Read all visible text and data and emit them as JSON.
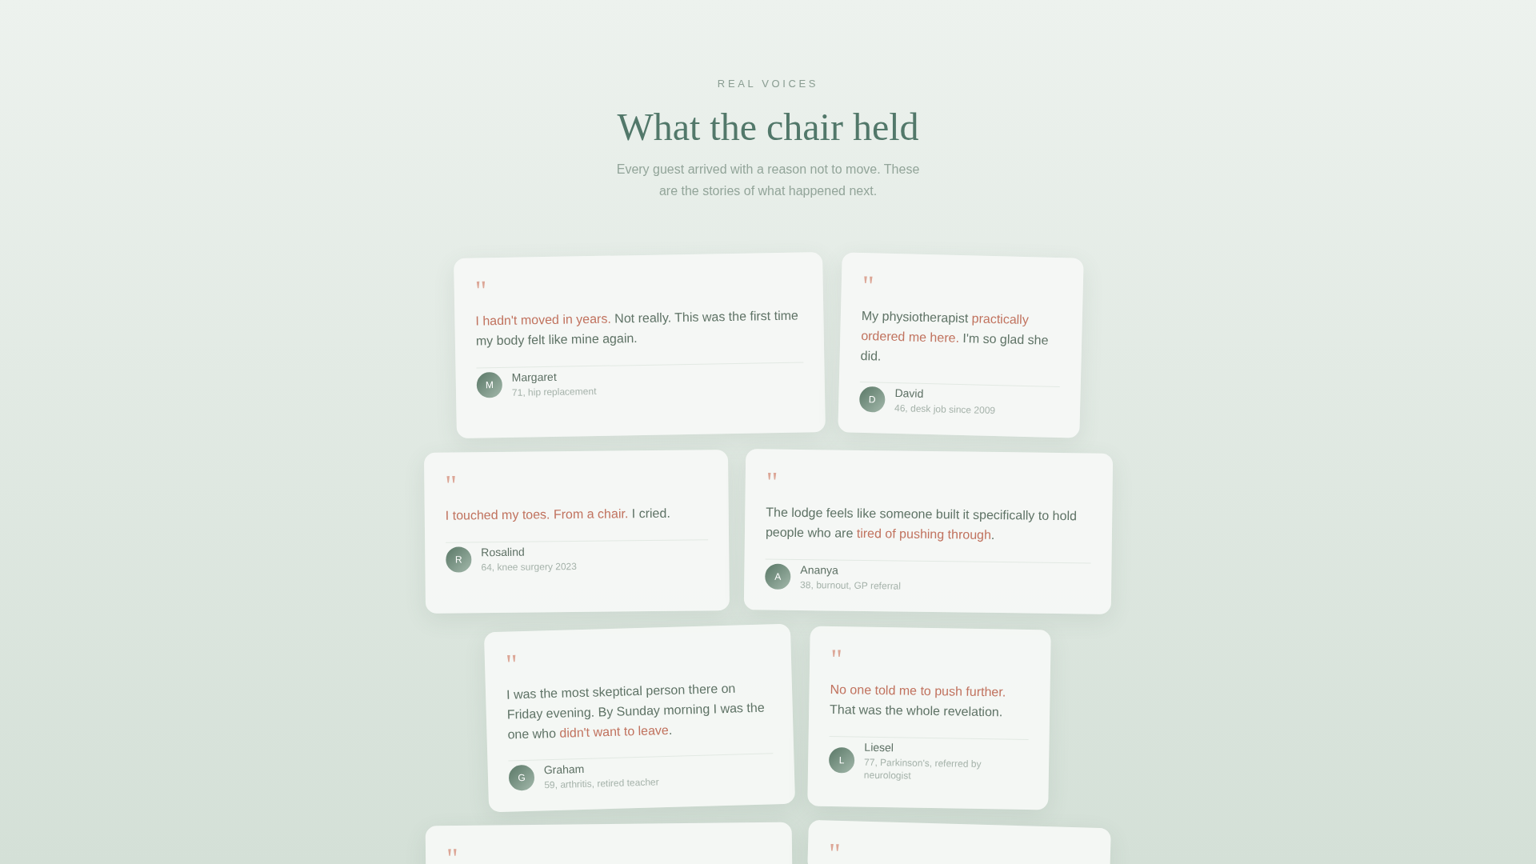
{
  "header": {
    "eyebrow": "REAL VOICES",
    "title": "What the chair held",
    "subtitle": "Every guest arrived with a reason not to move. These are the stories of what happened next."
  },
  "testimonials": [
    {
      "mark": "\"",
      "quote": [
        {
          "text": "I hadn't moved in years.",
          "highlight": true
        },
        {
          "text": " Not really. This was the first time my body felt like mine again.",
          "highlight": false
        }
      ],
      "author": {
        "initial": "M",
        "name": "Margaret",
        "detail": "71, hip replacement"
      }
    },
    {
      "mark": "\"",
      "quote": [
        {
          "text": "My physiotherapist ",
          "highlight": false
        },
        {
          "text": "practically ordered me here.",
          "highlight": true
        },
        {
          "text": " I'm so glad she did.",
          "highlight": false
        }
      ],
      "author": {
        "initial": "D",
        "name": "David",
        "detail": "46, desk job since 2009"
      }
    },
    {
      "mark": "\"",
      "quote": [
        {
          "text": "I touched my toes. From a chair.",
          "highlight": true
        },
        {
          "text": " I cried.",
          "highlight": false
        }
      ],
      "author": {
        "initial": "R",
        "name": "Rosalind",
        "detail": "64, knee surgery 2023"
      }
    },
    {
      "mark": "\"",
      "quote": [
        {
          "text": "The lodge feels like someone built it specifically to hold people who are ",
          "highlight": false
        },
        {
          "text": "tired of pushing through",
          "highlight": true
        },
        {
          "text": ".",
          "highlight": false
        }
      ],
      "author": {
        "initial": "A",
        "name": "Ananya",
        "detail": "38, burnout, GP referral"
      }
    },
    {
      "mark": "\"",
      "quote": [
        {
          "text": "I was the most skeptical person there on Friday evening. By Sunday morning I was the one who ",
          "highlight": false
        },
        {
          "text": "didn't want to leave",
          "highlight": true
        },
        {
          "text": ".",
          "highlight": false
        }
      ],
      "author": {
        "initial": "G",
        "name": "Graham",
        "detail": "59, arthritis, retired teacher"
      }
    },
    {
      "mark": "\"",
      "quote": [
        {
          "text": "No one told me to push further.",
          "highlight": true
        },
        {
          "text": " That was the whole revelation.",
          "highlight": false
        }
      ],
      "author": {
        "initial": "L",
        "name": "Liesel",
        "detail": "77, Parkinson's, referred by neurologist"
      }
    },
    {
      "mark": "\""
    },
    {
      "mark": "\""
    }
  ]
}
